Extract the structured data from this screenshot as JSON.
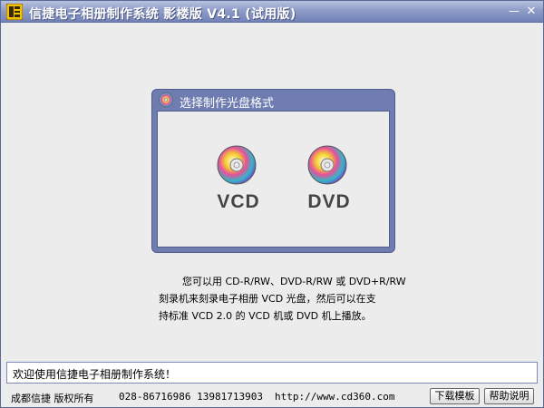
{
  "window": {
    "title": "信捷电子相册制作系统 影楼版 V4.1 (试用版)",
    "minimize_glyph": "—",
    "close_glyph": "✕"
  },
  "dialog": {
    "title": "选择制作光盘格式",
    "options": [
      {
        "label": "VCD"
      },
      {
        "label": "DVD"
      }
    ]
  },
  "info": {
    "lines": [
      "您可以用 CD-R/RW、DVD-R/RW 或 DVD+R/RW",
      "刻录机来刻录电子相册 VCD 光盘，然后可以在支",
      "持标准 VCD 2.0 的 VCD 机或 DVD 机上播放。"
    ]
  },
  "status": {
    "text": "欢迎使用信捷电子相册制作系统！"
  },
  "footer": {
    "company": "成都信捷 版权所有",
    "phone": "028-86716986 13981713903",
    "url": "http://www.cd360.com",
    "download_label": "下载模板",
    "help_label": "帮助说明"
  },
  "colors": {
    "titlebar": "#8e9cc8",
    "dialog_frame": "#6e7cb0",
    "window_bg": "#ececec"
  }
}
